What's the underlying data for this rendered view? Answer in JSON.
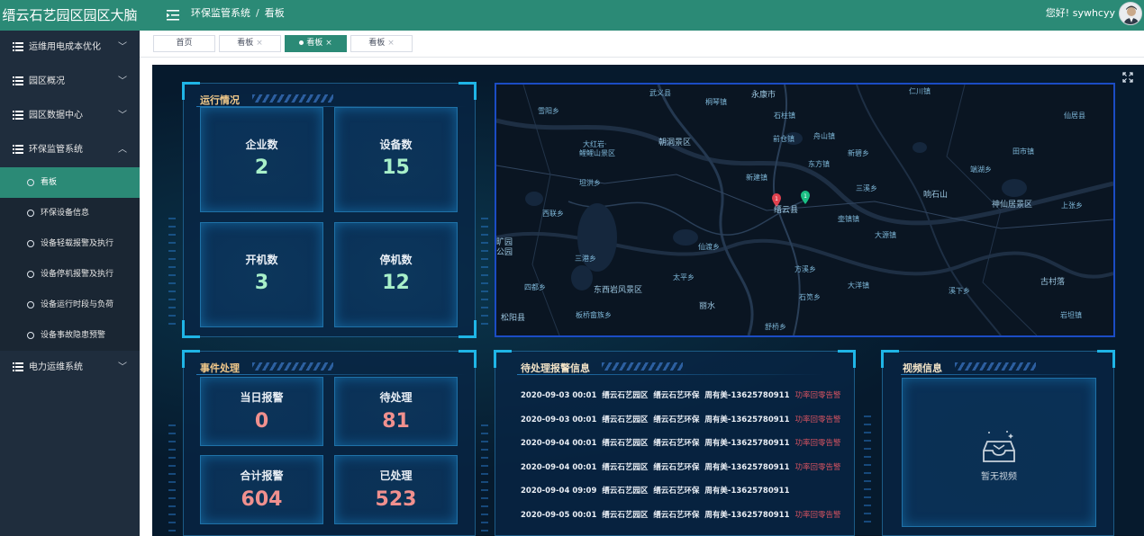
{
  "header": {
    "brand": "缙云石艺园区园区大脑",
    "breadcrumb": [
      "环保监管系统",
      "看板"
    ],
    "greeting": "您好! sywhcyy"
  },
  "sidebar": {
    "items": [
      {
        "label": "运维用电成本优化",
        "expanded": false
      },
      {
        "label": "园区概况",
        "expanded": false
      },
      {
        "label": "园区数据中心",
        "expanded": false
      },
      {
        "label": "环保监管系统",
        "expanded": true
      },
      {
        "label": "电力运维系统",
        "expanded": false
      }
    ],
    "subitems": [
      {
        "label": "看板",
        "active": true
      },
      {
        "label": "环保设备信息"
      },
      {
        "label": "设备轻载报警及执行"
      },
      {
        "label": "设备停机报警及执行"
      },
      {
        "label": "设备运行时段与负荷"
      },
      {
        "label": "设备事故隐患预警"
      }
    ]
  },
  "tabs": [
    {
      "label": "首页"
    },
    {
      "label": "看板",
      "close": "×"
    },
    {
      "label": "看板",
      "close": "×",
      "active": true
    },
    {
      "label": "看板",
      "close": "×"
    }
  ],
  "operation": {
    "title": "运行情况",
    "stats": [
      {
        "label": "企业数",
        "value": "2"
      },
      {
        "label": "设备数",
        "value": "15"
      },
      {
        "label": "开机数",
        "value": "3"
      },
      {
        "label": "停机数",
        "value": "12"
      }
    ]
  },
  "events": {
    "title": "事件处理",
    "stats": [
      {
        "label": "当日报警",
        "value": "0"
      },
      {
        "label": "待处理",
        "value": "81"
      },
      {
        "label": "合计报警",
        "value": "604"
      },
      {
        "label": "已处理",
        "value": "523"
      }
    ]
  },
  "alarms": {
    "title": "待处理报警信息",
    "rows": [
      {
        "time": "2020-09-03 00:01",
        "park": "缙云石艺园区",
        "company": "缙云石艺环保",
        "contact": "周有美-13625780911",
        "tag": "功率回零告警"
      },
      {
        "time": "2020-09-03 00:01",
        "park": "缙云石艺园区",
        "company": "缙云石艺环保",
        "contact": "周有美-13625780911",
        "tag": "功率回零告警"
      },
      {
        "time": "2020-09-04 00:01",
        "park": "缙云石艺园区",
        "company": "缙云石艺环保",
        "contact": "周有美-13625780911",
        "tag": "功率回零告警"
      },
      {
        "time": "2020-09-04 00:01",
        "park": "缙云石艺园区",
        "company": "缙云石艺环保",
        "contact": "周有美-13625780911",
        "tag": "功率回零告警"
      },
      {
        "time": "2020-09-04 09:09",
        "park": "缙云石艺园区",
        "company": "缙云石艺环保",
        "contact": "周有美-13625780911",
        "tag": ""
      },
      {
        "time": "2020-09-05 00:01",
        "park": "缙云石艺园区",
        "company": "缙云石艺环保",
        "contact": "周有美-13625780911",
        "tag": "功率回零告警"
      }
    ]
  },
  "video": {
    "title": "视频信息",
    "empty_text": "暂无视频"
  },
  "map": {
    "labels": [
      "武义县",
      "永康市",
      "仁川镇",
      "桐琴镇",
      "石柱镇",
      "仙居县",
      "雪阳乡",
      "大红岩·",
      "鲤鲤山景区",
      "朝洞景区",
      "前仓镇",
      "舟山镇",
      "田市镇",
      "东方镇",
      "新碧乡",
      "端湖乡",
      "新建镇",
      "坦洪乡",
      "三溪乡",
      "响石山",
      "缙云县",
      "神仙居景区",
      "上张乡",
      "西联乡",
      "壶镇镇",
      "大源镇",
      "旷园",
      "公园",
      "仙渡乡",
      "三港乡",
      "方溪乡",
      "大洋镇",
      "古村落",
      "太平乡",
      "四都乡",
      "东西岩风景区",
      "石笕乡",
      "溪下乡",
      "丽水",
      "松阳县",
      "板桥畲族乡",
      "舒桥乡",
      "岩坦镇"
    ],
    "markers": [
      {
        "label": "1",
        "color": "#e0424f"
      },
      {
        "label": "1",
        "color": "#1bbf84"
      }
    ]
  },
  "colors": {
    "header_bg": "#2b8a76",
    "sidebar_bg": "#1f2d3d",
    "dashboard_bg": "#061a2d",
    "title_gold": "#f2c98a",
    "value_green": "#a8f0c9",
    "value_red": "#f0908e",
    "alarm_tag": "#d15260"
  }
}
